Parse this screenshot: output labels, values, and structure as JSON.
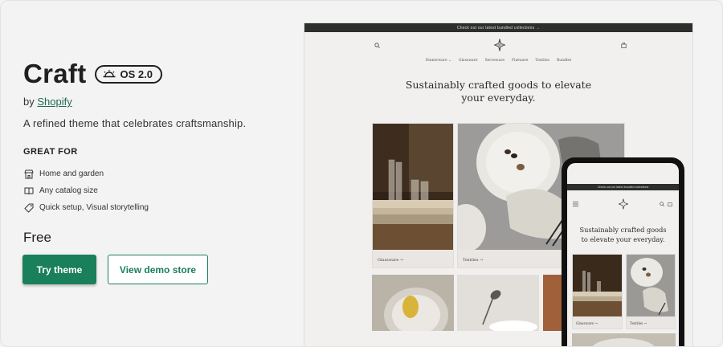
{
  "theme": {
    "name": "Craft",
    "badge": "OS 2.0",
    "by_prefix": "by",
    "author": "Shopify",
    "description": "A refined theme that celebrates craftsmanship.",
    "great_for_heading": "GREAT FOR",
    "features": [
      {
        "icon": "storefront-icon",
        "label": "Home and garden"
      },
      {
        "icon": "book-icon",
        "label": "Any catalog size"
      },
      {
        "icon": "tag-icon",
        "label": "Quick setup, Visual storytelling"
      }
    ],
    "price": "Free",
    "try_label": "Try theme",
    "demo_label": "View demo store"
  },
  "preview": {
    "announcement": "Check out our latest bundled collections →",
    "nav": [
      "Dinnerware ⌄",
      "Glassware",
      "Serveware",
      "Flatware",
      "Textiles",
      "Bundles"
    ],
    "hero_line1": "Sustainably crafted goods to elevate",
    "hero_line2": "your everyday.",
    "cards": [
      {
        "label": "Glassware →"
      },
      {
        "label": "Textiles →"
      }
    ]
  },
  "phone": {
    "announcement": "Check out our latest bundled collections",
    "hero_line1": "Sustainably crafted goods",
    "hero_line2": "to elevate your everyday.",
    "cards": [
      {
        "label": "Glassware →"
      },
      {
        "label": "Textiles →"
      }
    ]
  },
  "colors": {
    "accent": "#1a7f5b",
    "page_bg": "#f3f3f3"
  }
}
